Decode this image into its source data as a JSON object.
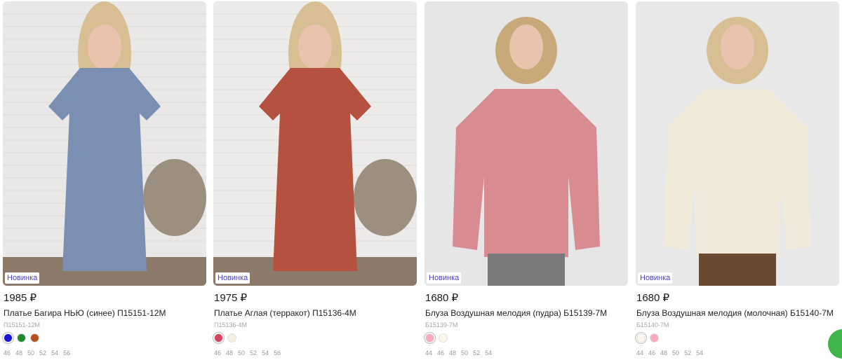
{
  "products": [
    {
      "badge": "Новинка",
      "price": "1985 ₽",
      "title": "Платье Багира НЬЮ (синее) П15151-12М",
      "article": "П15151-12М",
      "colors": [
        "#1a17d4",
        "#1f8a2e",
        "#b5531b"
      ],
      "sizes": [
        "46",
        "48",
        "50",
        "52",
        "54",
        "56"
      ],
      "image": {
        "bg": "#e9e8e6",
        "garment": "#7b8fb2",
        "garment_icon": "dress-icon"
      }
    },
    {
      "badge": "Новинка",
      "price": "1975 ₽",
      "title": "Платье Аглая (терракот) П15136-4М",
      "article": "П15136-4М",
      "colors": [
        "#d2475e",
        "#f5f0df"
      ],
      "sizes": [
        "46",
        "48",
        "50",
        "52",
        "54",
        "56"
      ],
      "image": {
        "bg": "#ecebea",
        "garment": "#b4523f",
        "garment_icon": "dress-icon"
      }
    },
    {
      "badge": "Новинка",
      "price": "1680 ₽",
      "title": "Блуза Воздушная мелодия (пудра) Б15139-7М",
      "article": "Б15139-7М",
      "colors": [
        "#f7a9bf",
        "#fbf7ea"
      ],
      "sizes": [
        "44",
        "46",
        "48",
        "50",
        "52",
        "54"
      ],
      "image": {
        "bg": "#e6e6e6",
        "garment": "#d88c92",
        "garment_icon": "blouse-icon"
      }
    },
    {
      "badge": "Новинка",
      "price": "1680 ₽",
      "title": "Блуза Воздушная мелодия (молочная) Б15140-7М",
      "article": "Б15140-7М",
      "colors": [
        "#fbf7ea",
        "#f7a9bf"
      ],
      "sizes": [
        "44",
        "46",
        "48",
        "50",
        "52",
        "54"
      ],
      "image": {
        "bg": "#e8e8e8",
        "garment": "#f1e9d9",
        "garment_icon": "blouse-icon"
      }
    }
  ],
  "chat_button_icon": "chat-icon",
  "accent_color": "#3fb449"
}
